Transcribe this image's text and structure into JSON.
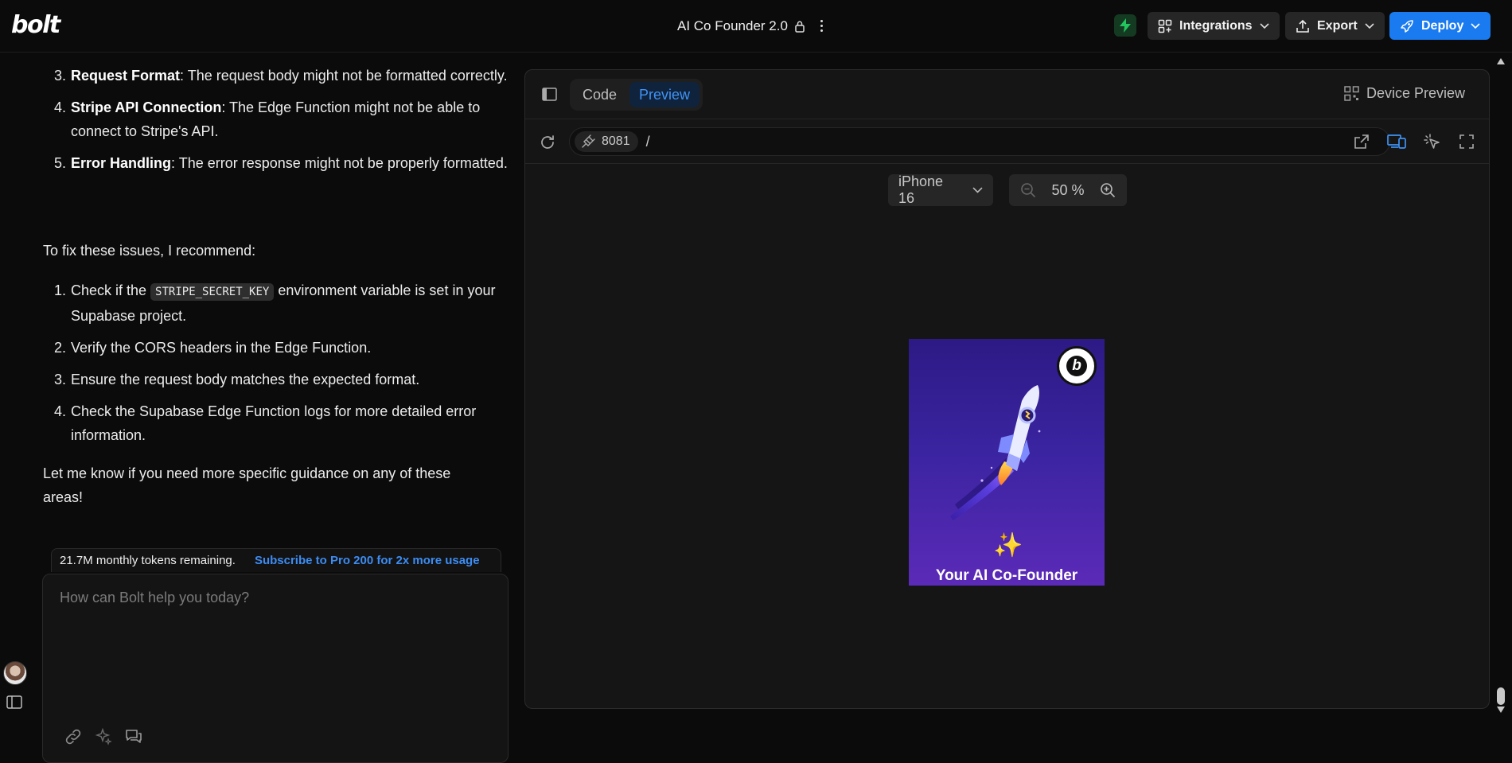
{
  "header": {
    "logo": "bolt",
    "project_title": "AI Co Founder 2.0",
    "integrations_label": "Integrations",
    "export_label": "Export",
    "deploy_label": "Deploy"
  },
  "chat": {
    "list1": [
      {
        "num": "3.",
        "bold": "Request Format",
        "text": ": The request body might not be formatted correctly."
      },
      {
        "num": "4.",
        "bold": "Stripe API Connection",
        "text": ": The Edge Function might not be able to connect to Stripe's API."
      },
      {
        "num": "5.",
        "bold": "Error Handling",
        "text": ": The error response might not be properly formatted."
      }
    ],
    "intro": "To fix these issues, I recommend:",
    "list2_item1_pre": "Check if the ",
    "list2_item1_code": "STRIPE_SECRET_KEY",
    "list2_item1_post": " environment variable is set in your Supabase project.",
    "list2_item2": "Verify the CORS headers in the Edge Function.",
    "list2_item3": "Ensure the request body matches the expected format.",
    "list2_item4": "Check the Supabase Edge Function logs for more detailed error information.",
    "outro": "Let me know if you need more specific guidance on any of these areas!",
    "tokens_remaining": "21.7M monthly tokens remaining.",
    "subscribe_link": "Subscribe to Pro 200 for 2x more usage",
    "composer_placeholder": "How can Bolt help you today?"
  },
  "preview": {
    "tab_code": "Code",
    "tab_preview": "Preview",
    "active_tab": "Preview",
    "device_preview_label": "Device Preview",
    "port": "8081",
    "path": "/",
    "device": "iPhone 16",
    "zoom": "50 %",
    "app_title": "Your AI Co-Founder",
    "badge_letter": "b"
  },
  "colors": {
    "accent": "#1a7bf0",
    "active_tab_text": "#3f93f5",
    "bolt_status": "#22c55e"
  }
}
